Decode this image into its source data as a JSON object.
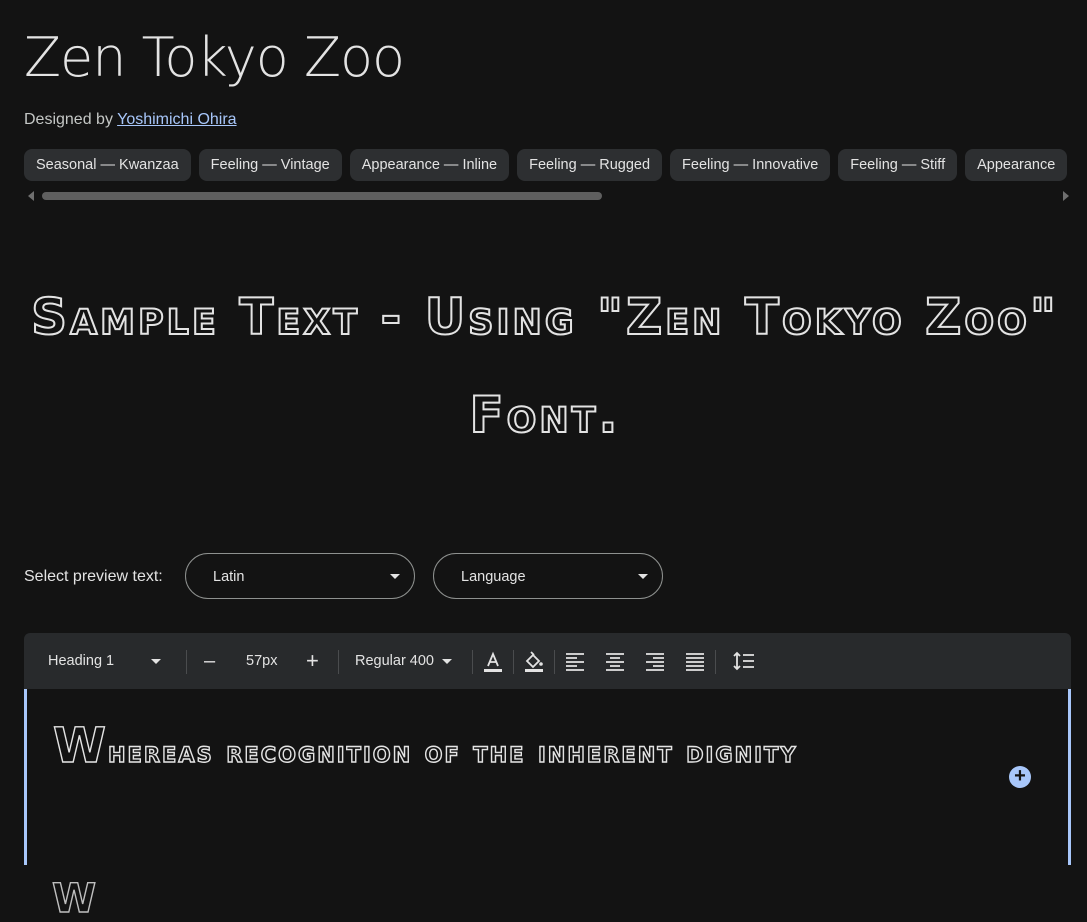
{
  "font": {
    "title": "Zen Tokyo Zoo",
    "designed_by_label": "Designed by",
    "designer": "Yoshimichi Ohira"
  },
  "tags": [
    "Seasonal — Kwanzaa",
    "Feeling — Vintage",
    "Appearance — Inline",
    "Feeling — Rugged",
    "Feeling — Innovative",
    "Feeling — Stiff",
    "Appearance"
  ],
  "sample_text": "Sample Text - Using \"Zen Tokyo Zoo\" Font.",
  "preview": {
    "label": "Select preview text:",
    "script_value": "Latin",
    "language_value": "Language"
  },
  "toolbar": {
    "style": "Heading 1",
    "size": "57px",
    "weight": "Regular 400",
    "minus": "–",
    "plus": "+"
  },
  "editor": {
    "text": "Whereas recognition of the inherent dignity",
    "next_line_peek": "W"
  },
  "colors": {
    "background": "#131313",
    "accent": "#a8c7fa",
    "chip": "#2d2f31",
    "toolbar": "#282a2c"
  },
  "icons": [
    "text-color-icon",
    "highlight-icon",
    "align-left-icon",
    "align-center-icon",
    "align-right-icon",
    "align-justify-icon",
    "line-spacing-icon",
    "add-icon"
  ]
}
